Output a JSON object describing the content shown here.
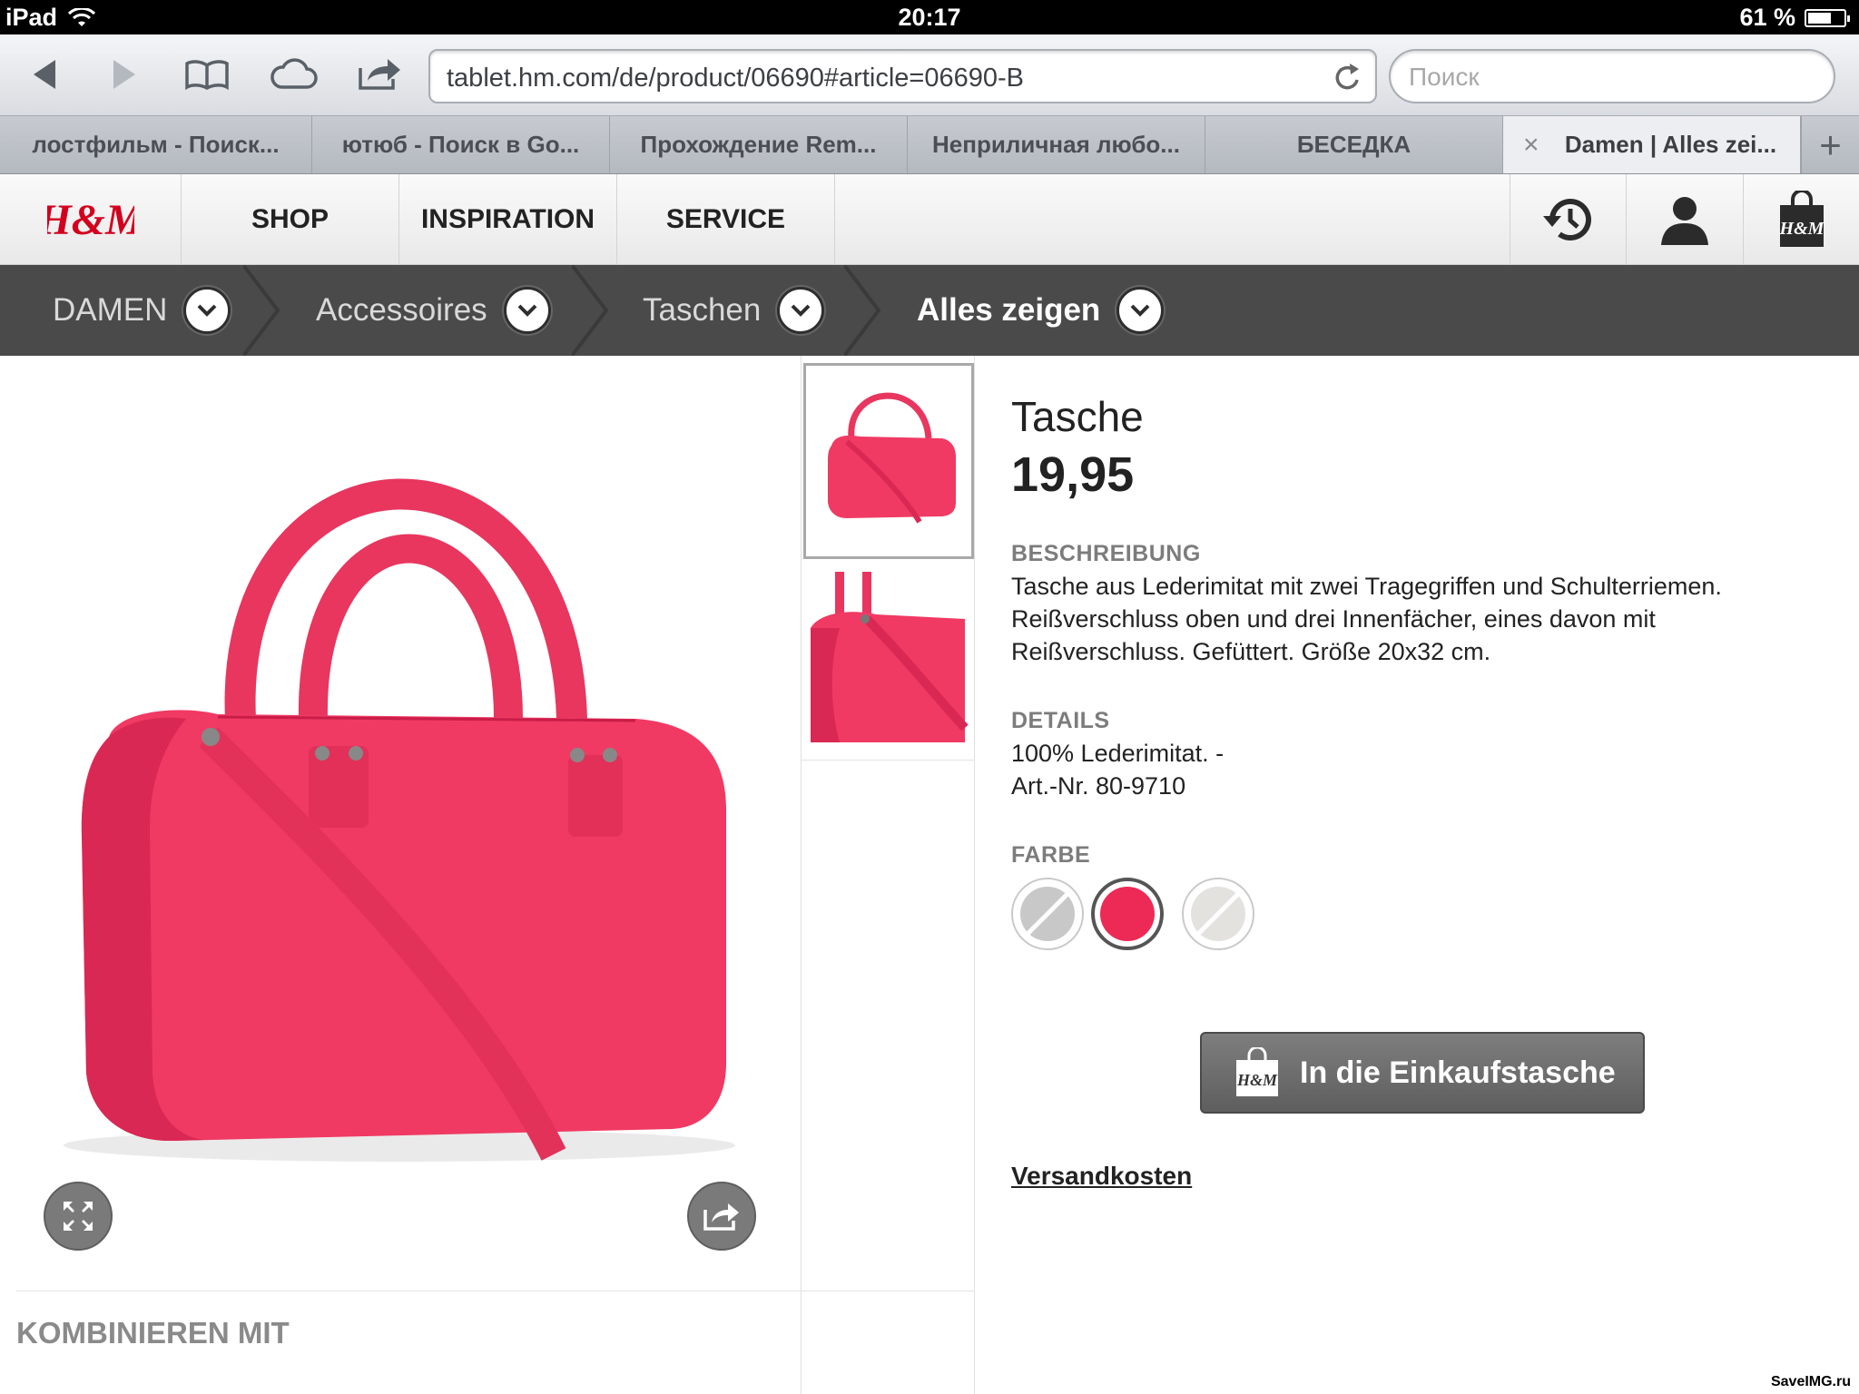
{
  "statusbar": {
    "device": "iPad",
    "time": "20:17",
    "battery": "61 %"
  },
  "browser": {
    "url": "tablet.hm.com/de/product/06690#article=06690-B",
    "search_placeholder": "Поиск",
    "tabs": [
      {
        "label": "лостфильм - Поиск..."
      },
      {
        "label": "ютюб - Поиск в Go..."
      },
      {
        "label": "Прохождение Rem..."
      },
      {
        "label": "Неприличная любо..."
      },
      {
        "label": "БЕСЕДКА"
      },
      {
        "label": "Damen | Alles zei..."
      }
    ],
    "tab_close": "×",
    "tab_add": "+"
  },
  "site": {
    "logo": "H&M",
    "nav": [
      "SHOP",
      "INSPIRATION",
      "SERVICE"
    ],
    "breadcrumb": [
      "DAMEN",
      "Accessoires",
      "Taschen",
      "Alles zeigen"
    ]
  },
  "product": {
    "title": "Tasche",
    "price": "19,95",
    "description_label": "BESCHREIBUNG",
    "description": "Tasche aus Lederimitat mit zwei Tragegriffen und Schulterriemen. Reißverschluss oben und drei Innenfächer, eines davon mit Reißverschluss. Gefüttert. Größe 20x32 cm.",
    "details_label": "DETAILS",
    "details_line1": "100% Lederimitat. -",
    "details_line2": "Art.-Nr. 80-9710",
    "color_label": "FARBE",
    "colors": [
      "#c8c8c8",
      "#ec2a55",
      "#e4e2de"
    ],
    "add_to_cart": "In die Einkaufstasche",
    "shipping_link": "Versandkosten",
    "bag_color": "#f03a63"
  },
  "combine_label": "KOMBINIEREN MIT",
  "watermark": "SaveIMG.ru"
}
